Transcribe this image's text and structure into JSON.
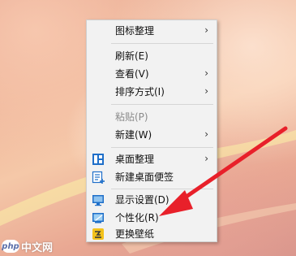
{
  "context_menu": {
    "items": [
      {
        "label": "图标整理",
        "submenu": true,
        "icon": null,
        "disabled": false
      },
      {
        "label": "刷新(E)",
        "submenu": false,
        "icon": null,
        "disabled": false
      },
      {
        "label": "查看(V)",
        "submenu": true,
        "icon": null,
        "disabled": false
      },
      {
        "label": "排序方式(I)",
        "submenu": true,
        "icon": null,
        "disabled": false
      },
      {
        "label": "粘贴(P)",
        "submenu": false,
        "icon": null,
        "disabled": true
      },
      {
        "label": "新建(W)",
        "submenu": true,
        "icon": null,
        "disabled": false
      },
      {
        "label": "桌面整理",
        "submenu": true,
        "icon": "desktop-organize-icon",
        "disabled": false
      },
      {
        "label": "新建桌面便签",
        "submenu": false,
        "icon": "desktop-note-icon",
        "disabled": false
      },
      {
        "label": "显示设置(D)",
        "submenu": false,
        "icon": "display-settings-icon",
        "disabled": false
      },
      {
        "label": "个性化(R)",
        "submenu": false,
        "icon": "personalize-icon",
        "disabled": false
      },
      {
        "label": "更换壁纸",
        "submenu": false,
        "icon": "change-wallpaper-icon",
        "disabled": false
      }
    ],
    "submenu_glyph": "›"
  },
  "watermark": {
    "logo_text": "php",
    "site_text": "中文网"
  },
  "colors": {
    "arrow": "#e8202a",
    "menu_bg": "#f2f2f2",
    "disabled_text": "#8a8a8a",
    "icon_blue": "#1f6fc9"
  }
}
